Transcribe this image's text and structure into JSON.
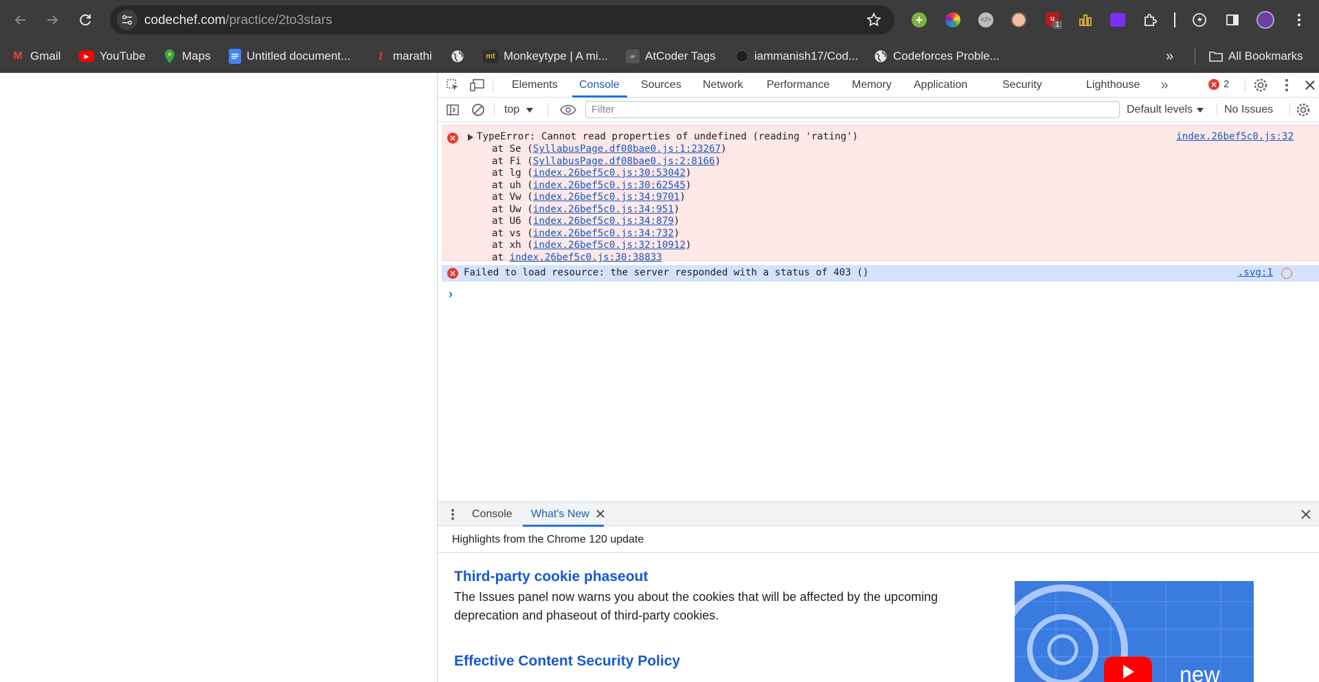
{
  "browser": {
    "url_domain": "codechef.com",
    "url_path": "/practice/2to3stars",
    "bookmarks": [
      {
        "label": "Gmail"
      },
      {
        "label": "YouTube"
      },
      {
        "label": "Maps"
      },
      {
        "label": "Untitled document..."
      },
      {
        "label": "marathi"
      },
      {
        "label": ""
      },
      {
        "label": "Monkeytype | A mi..."
      },
      {
        "label": "AtCoder Tags"
      },
      {
        "label": "iammanish17/Cod..."
      },
      {
        "label": "Codeforces Proble..."
      }
    ],
    "all_bookmarks": "All Bookmarks",
    "extension_badge": "1"
  },
  "devtools": {
    "tabs": [
      "Elements",
      "Console",
      "Sources",
      "Network",
      "Performance",
      "Memory",
      "Application",
      "Security",
      "Lighthouse"
    ],
    "active_tab": "Console",
    "error_count": "2",
    "console_bar": {
      "context": "top",
      "filter_placeholder": "Filter",
      "levels": "Default levels",
      "issues": "No Issues"
    },
    "messages": [
      {
        "type": "error",
        "text": "TypeError: Cannot read properties of undefined (reading 'rating')",
        "source": "index.26bef5c0.js:32",
        "stack": [
          {
            "prefix": "at Se (",
            "link": "SyllabusPage.df08bae0.js:1:23267",
            "suffix": ")"
          },
          {
            "prefix": "at Fi (",
            "link": "SyllabusPage.df08bae0.js:2:8166",
            "suffix": ")"
          },
          {
            "prefix": "at lg (",
            "link": "index.26bef5c0.js:30:53042",
            "suffix": ")"
          },
          {
            "prefix": "at uh (",
            "link": "index.26bef5c0.js:30:62545",
            "suffix": ")"
          },
          {
            "prefix": "at Vw (",
            "link": "index.26bef5c0.js:34:9701",
            "suffix": ")"
          },
          {
            "prefix": "at Uw (",
            "link": "index.26bef5c0.js:34:951",
            "suffix": ")"
          },
          {
            "prefix": "at U6 (",
            "link": "index.26bef5c0.js:34:879",
            "suffix": ")"
          },
          {
            "prefix": "at vs (",
            "link": "index.26bef5c0.js:34:732",
            "suffix": ")"
          },
          {
            "prefix": "at xh (",
            "link": "index.26bef5c0.js:32:10912",
            "suffix": ")"
          },
          {
            "prefix": "at ",
            "link": "index.26bef5c0.js:30:38833",
            "suffix": ""
          }
        ]
      },
      {
        "type": "error",
        "text": "Failed to load resource: the server responded with a status of 403 ()",
        "source": ".svg:1"
      }
    ],
    "drawer": {
      "tabs": [
        "Console",
        "What's New"
      ],
      "active_tab": "What's New",
      "highlights": "Highlights from the Chrome 120 update",
      "sections": [
        {
          "title": "Third-party cookie phaseout",
          "body": "The Issues panel now warns you about the cookies that will be affected by the upcoming deprecation and phaseout of third-party cookies."
        },
        {
          "title": "Effective Content Security Policy"
        }
      ],
      "video_label": "new"
    }
  },
  "colors": {
    "chrome_bg": "#3c3c3c",
    "error_bg": "#fce8e6",
    "selected_row_bg": "#d3e3fd",
    "accent": "#1a73e8",
    "error_red": "#e33b30"
  }
}
